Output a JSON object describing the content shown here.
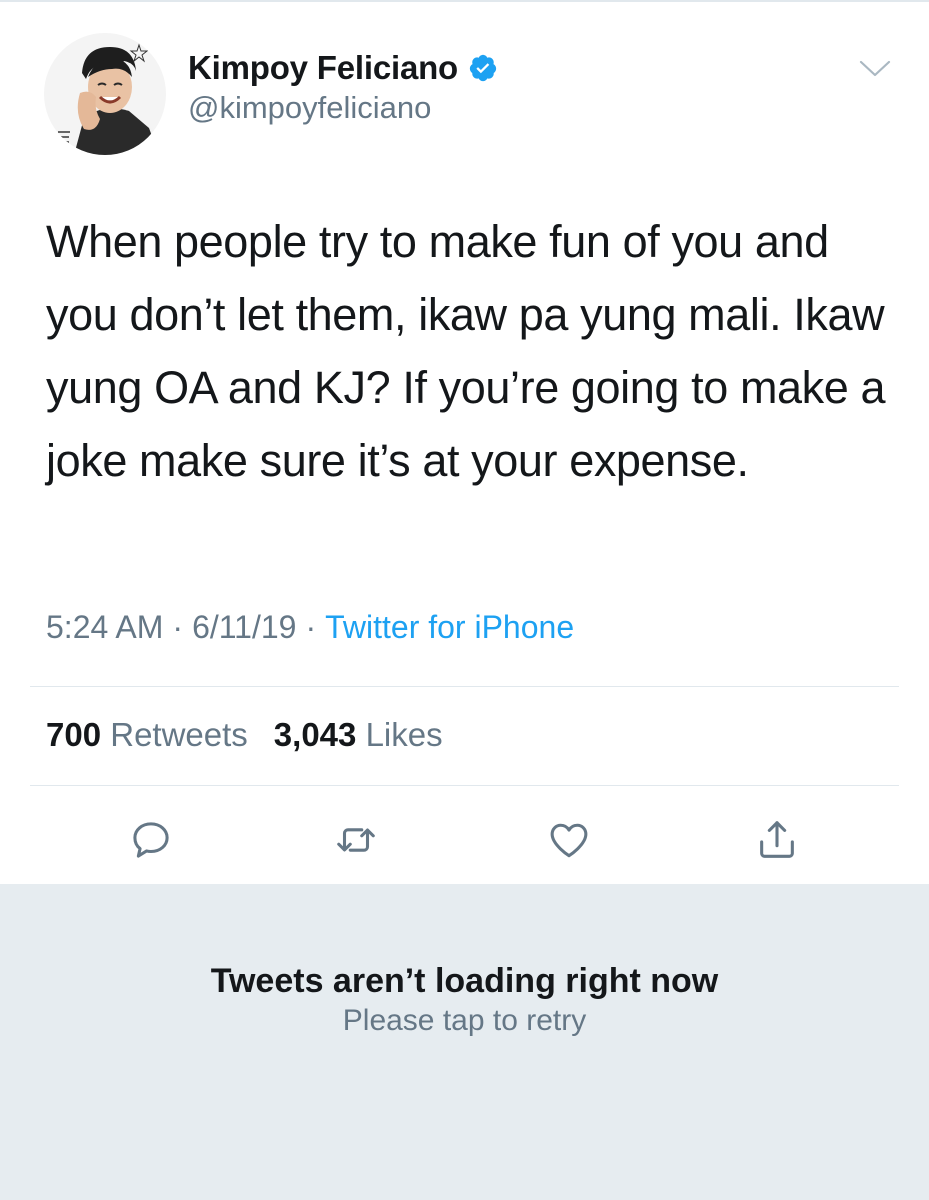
{
  "tweet": {
    "author": {
      "display_name": "Kimpoy Feliciano",
      "handle": "@kimpoyfeliciano",
      "verified": true,
      "verified_badge_color": "#1da1f2"
    },
    "text": "When people try to make fun of you and you don’t let them, ikaw pa yung mali. Ikaw yung OA and KJ? If you’re going to make a joke make sure it’s at your expense.",
    "time": "5:24 AM",
    "date": "6/11/19",
    "separator": "·",
    "source": "Twitter for iPhone",
    "stats": {
      "retweets_count": "700",
      "retweets_label": "Retweets",
      "likes_count": "3,043",
      "likes_label": "Likes"
    },
    "actions": [
      "reply-icon",
      "retweet-icon",
      "like-icon",
      "share-icon"
    ]
  },
  "error_panel": {
    "title": "Tweets aren’t loading right now",
    "subtitle": "Please tap to retry"
  },
  "colors": {
    "text_primary": "#14171a",
    "text_secondary": "#657786",
    "link": "#1da1f2",
    "divider": "#e1e8ed",
    "panel_background": "#e6ecf0"
  }
}
